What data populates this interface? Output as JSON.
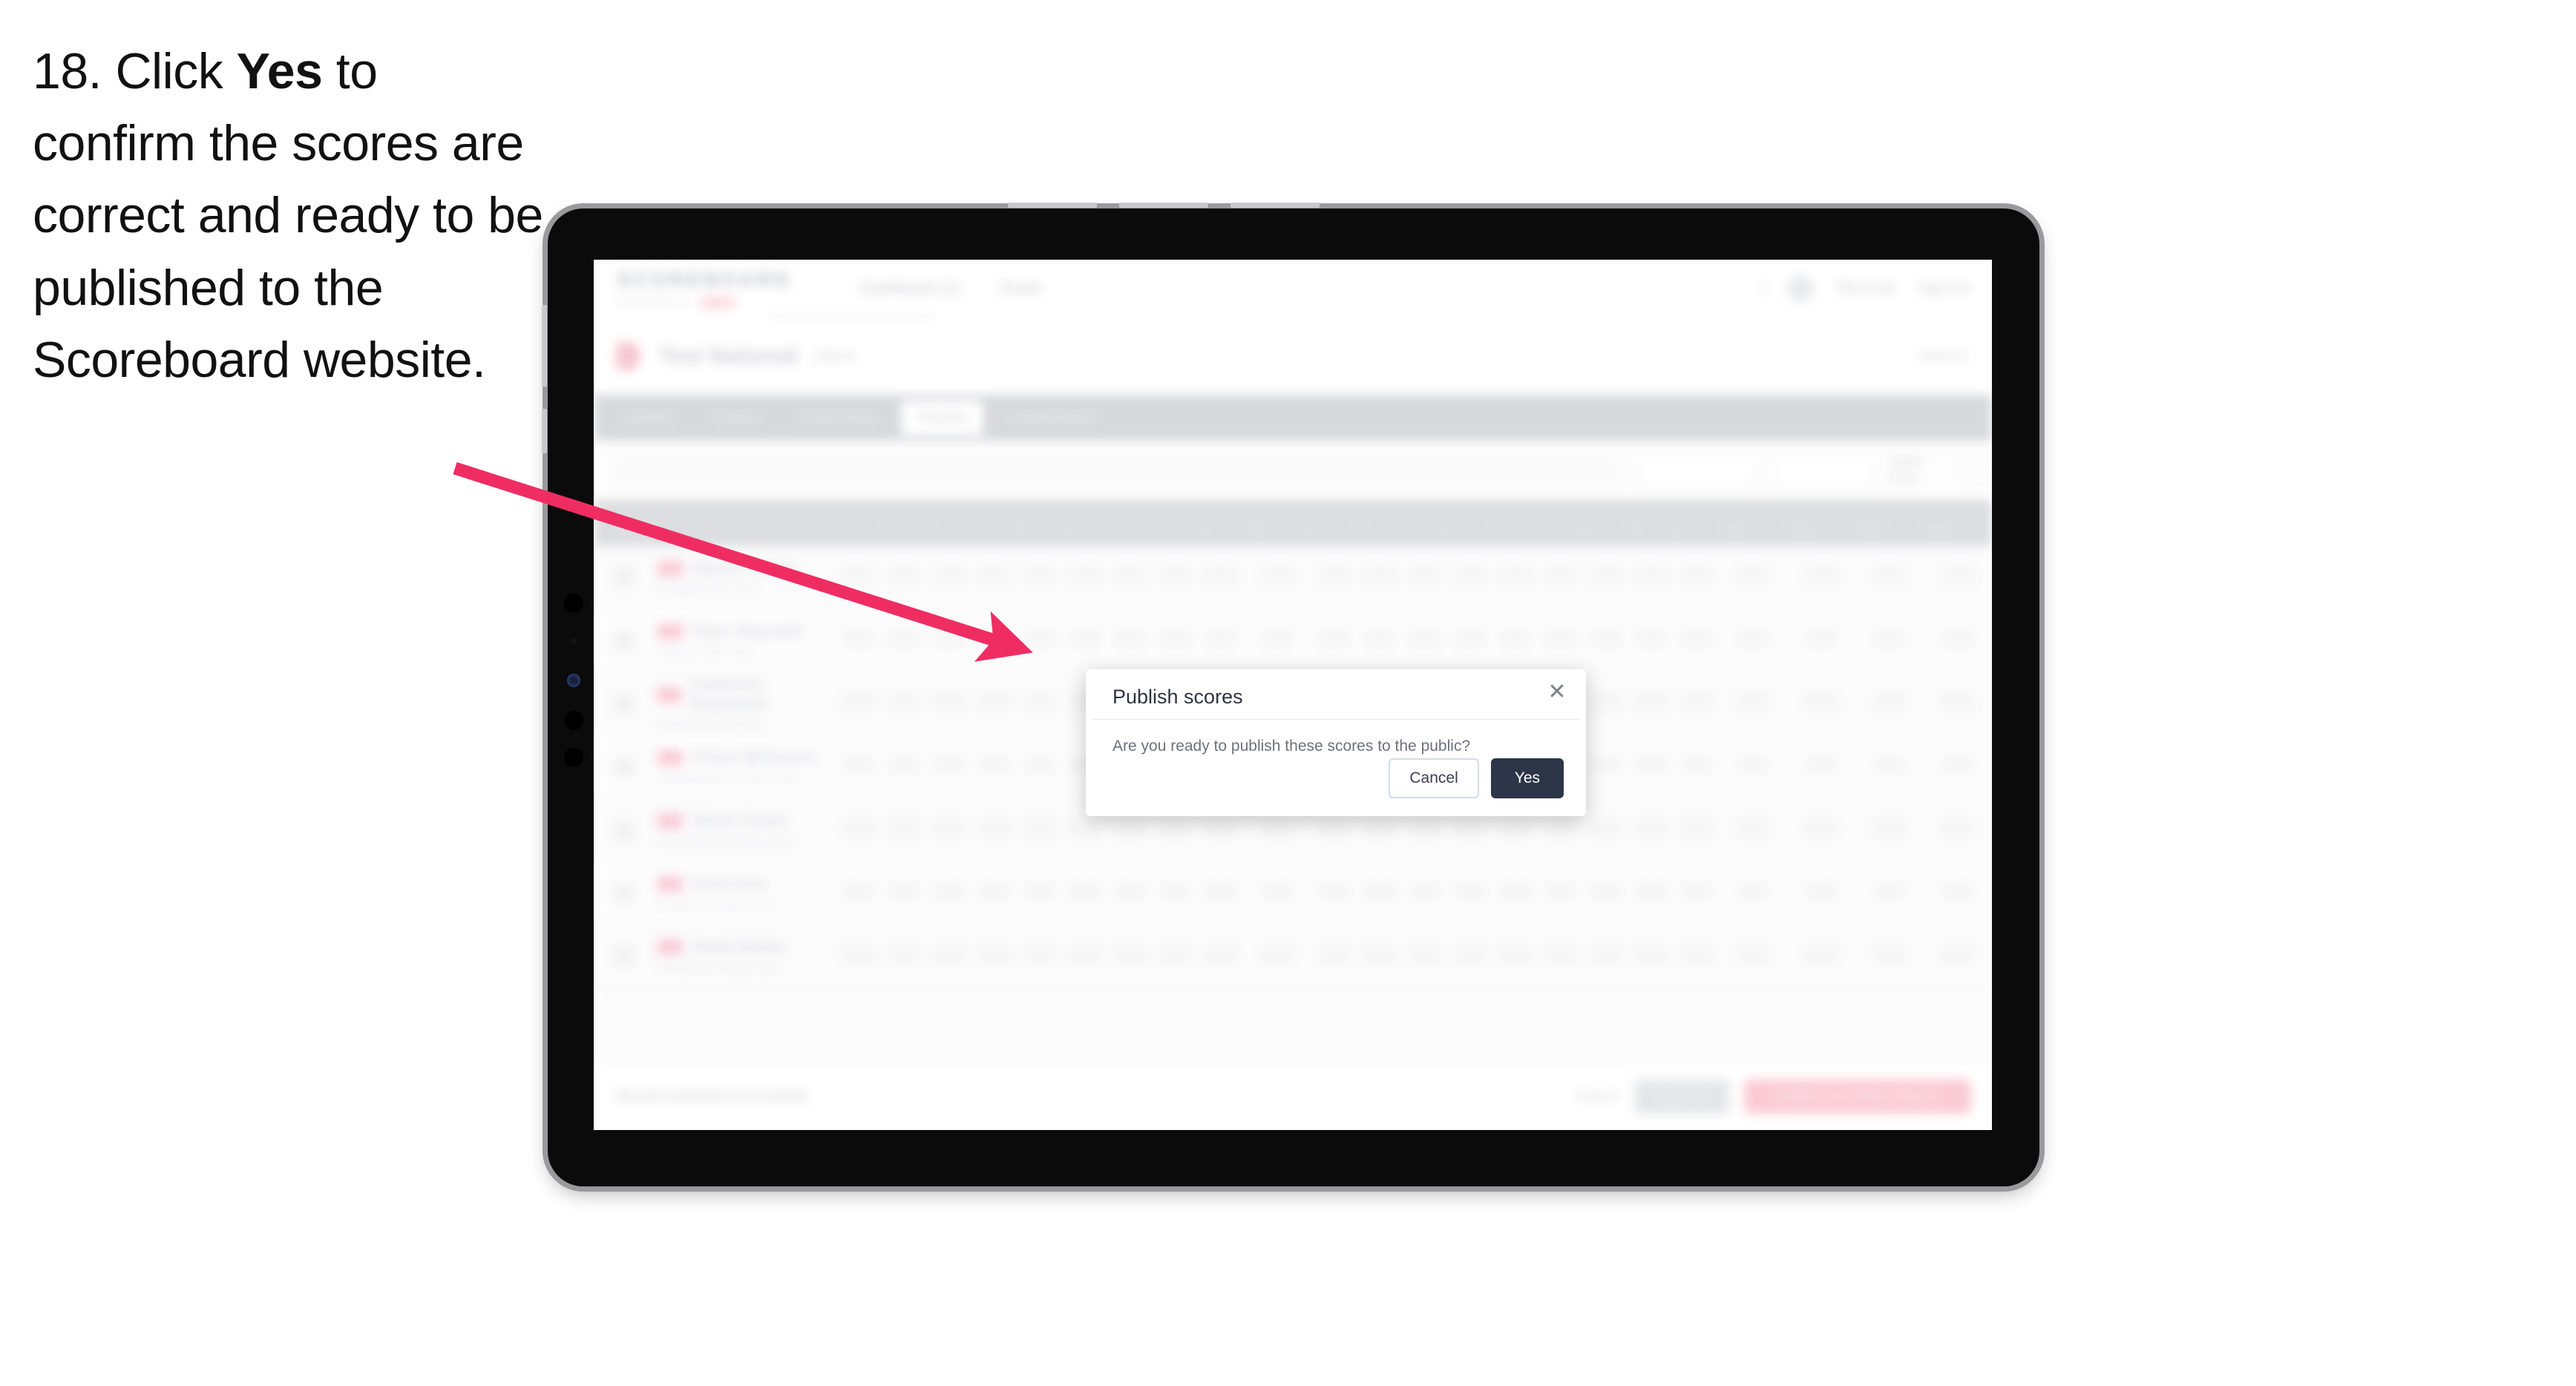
{
  "instruction": {
    "number": "18.",
    "text_before": "Click ",
    "emphasis": "Yes",
    "text_after": " to confirm the scores are correct and ready to be published to the Scoreboard website."
  },
  "annotation": {
    "arrow_color": "#ef2d62",
    "arrow_start": "613,631",
    "arrow_end": "1382,876"
  },
  "device": {
    "type": "tablet",
    "body_color": "#0b0b0c",
    "bezel_color": "#9a9a9c"
  },
  "app": {
    "header": {
      "brand": "SCOREBOARD",
      "brand_sub": "POWERED BY",
      "brand_pill": "BETA",
      "nav": [
        "Dashboard (1)",
        "Event"
      ],
      "user_name": "Test User",
      "sign_out": "Sign out"
    },
    "event": {
      "title": "Test National",
      "subtitle": "2024",
      "right_label": "Level 3"
    },
    "tabs": [
      {
        "label": "Details",
        "active": false
      },
      {
        "label": "Teams",
        "active": false
      },
      {
        "label": "Event Book",
        "active": false
      },
      {
        "label": "Results",
        "active": true
      },
      {
        "label": "Leaderboard",
        "active": false
      }
    ],
    "filters": {
      "search_placeholder": "Search",
      "select_1": "All Sessions",
      "select_2": "Round 1",
      "button": "Table Only"
    },
    "table": {
      "columns_player": "Player",
      "columns_numbers": [
        "1",
        "2",
        "3",
        "4",
        "5",
        "6",
        "7",
        "8",
        "9",
        "10",
        "11",
        "12",
        "13",
        "14",
        "15",
        "16",
        "17",
        "18"
      ],
      "columns_extra": [
        "Net",
        "Total",
        "Gross",
        "Points",
        "Status"
      ],
      "rows": [
        {
          "name": "Mason Turner",
          "club": "Coastal Links Club",
          "flag": "#f5a0b8"
        },
        {
          "name": "Piper Reynold",
          "club": "Hillcrest Golf Club",
          "flag": "#f5a0b8"
        },
        {
          "name": "Cameron Redmond",
          "club": "Redwood Park Club",
          "flag": "#f5a0b8"
        },
        {
          "name": "Chloe Whitmore",
          "club": "Summerfield Country Club",
          "flag": "#f5a0b8"
        },
        {
          "name": "Oliver Grant",
          "club": "Northgate Meadows Club",
          "flag": "#f5a0b8"
        },
        {
          "name": "Rosa Kim",
          "club": "Pinehurst Greens Club",
          "flag": "#f5a0b8"
        },
        {
          "name": "Noah Bailey",
          "club": "Westbrook Valley Club",
          "flag": "#f5a0b8"
        }
      ]
    },
    "footer": {
      "note": "Results published successfully",
      "link": "Cancel",
      "secondary_button": "Save All",
      "primary_button": "Publish and Notify Players"
    }
  },
  "modal": {
    "title": "Publish scores",
    "message": "Are you ready to publish these scores to the public?",
    "cancel_label": "Cancel",
    "confirm_label": "Yes",
    "close_icon": "✕",
    "confirm_color": "#2c3648"
  }
}
